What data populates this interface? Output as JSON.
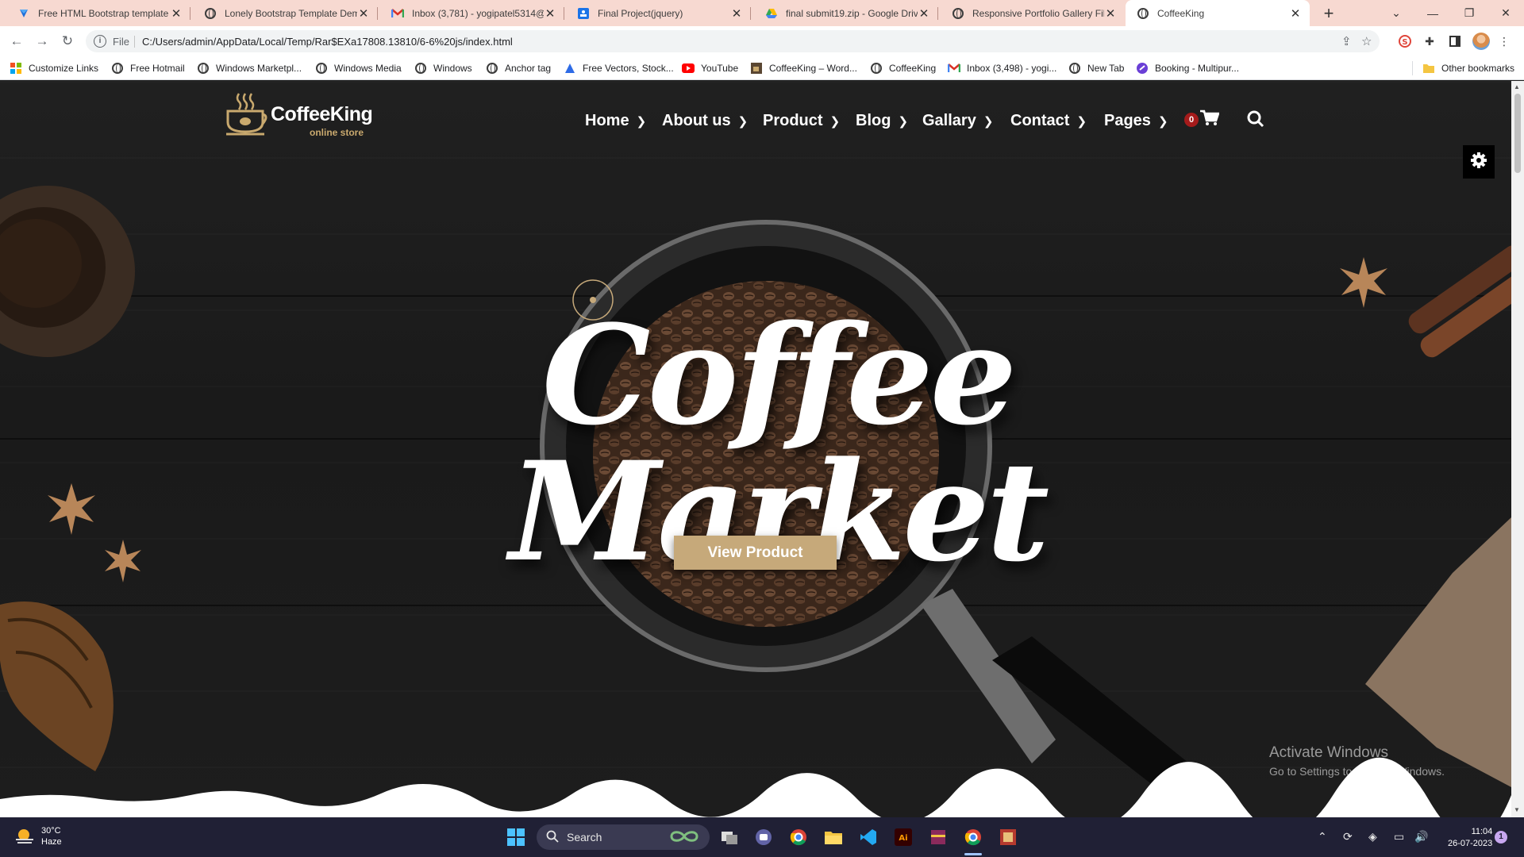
{
  "browser": {
    "tabs": [
      {
        "title": "Free HTML Bootstrap template -",
        "icon": "bootstrap-icon",
        "active": false
      },
      {
        "title": "Lonely Bootstrap Template Dem",
        "icon": "globe-icon",
        "active": false
      },
      {
        "title": "Inbox (3,781) - yogipatel5314@",
        "icon": "gmail-icon",
        "active": false
      },
      {
        "title": "Final Project(jquery)",
        "icon": "slides-icon",
        "active": false
      },
      {
        "title": "final submit19.zip - Google Driv",
        "icon": "google-drive-icon",
        "active": false
      },
      {
        "title": "Responsive Portfolio Gallery Filte",
        "icon": "globe-icon",
        "active": false
      },
      {
        "title": "CoffeeKing",
        "icon": "globe-icon",
        "active": true
      }
    ],
    "new_tab_label": "+",
    "address": {
      "scheme": "File",
      "url": "C:/Users/admin/AppData/Local/Temp/Rar$EXa17808.13810/6-6%20js/index.html"
    },
    "bookmarks": [
      {
        "label": "Customize Links",
        "icon": "windows-logo-icon"
      },
      {
        "label": "Free Hotmail",
        "icon": "globe-icon"
      },
      {
        "label": "Windows Marketpl...",
        "icon": "globe-icon"
      },
      {
        "label": "Windows Media",
        "icon": "globe-icon"
      },
      {
        "label": "Windows",
        "icon": "globe-icon"
      },
      {
        "label": "Anchor tag",
        "icon": "globe-icon"
      },
      {
        "label": "Free Vectors, Stock...",
        "icon": "freepik-icon"
      },
      {
        "label": "YouTube",
        "icon": "youtube-icon"
      },
      {
        "label": "CoffeeKing – Word...",
        "icon": "coffeeking-icon"
      },
      {
        "label": "CoffeeKing",
        "icon": "globe-icon"
      },
      {
        "label": "Inbox (3,498) - yogi...",
        "icon": "gmail-icon"
      },
      {
        "label": "New Tab",
        "icon": "globe-icon"
      },
      {
        "label": "Booking - Multipur...",
        "icon": "booking-icon"
      }
    ],
    "other_bookmarks": "Other bookmarks"
  },
  "site": {
    "logo": {
      "name": "CoffeeKing",
      "tagline": "online store"
    },
    "nav": [
      "Home",
      "About us",
      "Product",
      "Blog",
      "Gallary",
      "Contact",
      "Pages"
    ],
    "cart_count": "0",
    "hero": {
      "title": "Coffee Market",
      "button": "View Product"
    }
  },
  "watermark": {
    "line1": "Activate Windows",
    "line2": "Go to Settings to activate Windows."
  },
  "taskbar": {
    "weather": {
      "temp": "30°C",
      "condition": "Haze"
    },
    "search_label": "Search",
    "time": "11:04",
    "date": "26-07-2023",
    "notification_count": "1"
  },
  "colors": {
    "accent": "#c6a97a",
    "badge": "#a51b1b",
    "tabbar": "#f7d9d1",
    "taskbar": "#202035"
  }
}
